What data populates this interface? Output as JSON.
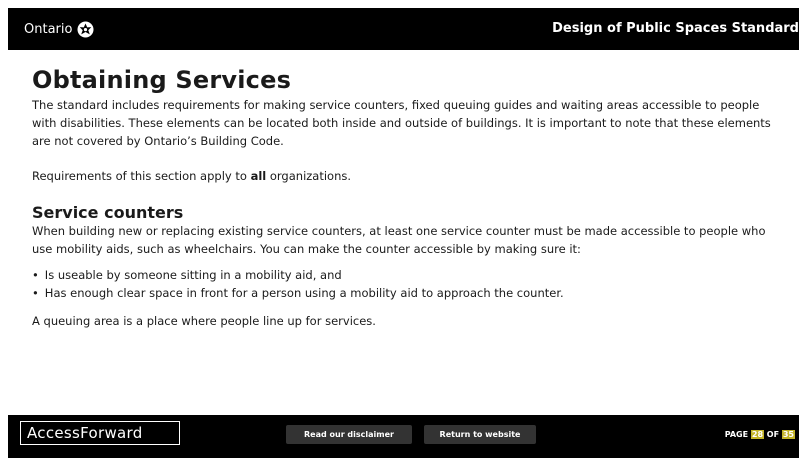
{
  "header": {
    "brand": "Ontario",
    "icon": "ontario-trillium-icon",
    "doc_title": "Design of Public Spaces Standard"
  },
  "main": {
    "title": "Obtaining Services",
    "intro": "The standard includes requirements for making service counters, fixed queuing guides and waiting areas accessible to people with disabilities. These elements can be located both inside and outside of buildings. It is important to note that these elements are not covered by Ontario’s Building Code.",
    "applies_before": "Requirements of this section apply to ",
    "applies_bold": "all",
    "applies_after": " organizations.",
    "section_title": "Service counters",
    "section_body": "When building new or replacing existing service counters, at least one service counter must be made accessible to people who use mobility aids, such as wheelchairs. You can make the counter accessible by making sure it:",
    "bullets": [
      "Is useable by someone sitting in a mobility aid, and",
      "Has enough clear space in front for a person using a mobility aid to approach the counter."
    ],
    "bullet_char": "•",
    "queue_text": "A queuing area is a place where people line up for services."
  },
  "footer": {
    "logo": "AccessForward",
    "disclaimer_label": "Read our disclaimer",
    "return_label": "Return to website",
    "page_prefix": "PAGE ",
    "page_current": "28",
    "page_of": " OF ",
    "page_total": "35"
  },
  "colors": {
    "bar": "#000000",
    "page_highlight": "#c2b327",
    "footer_button": "#333333"
  }
}
